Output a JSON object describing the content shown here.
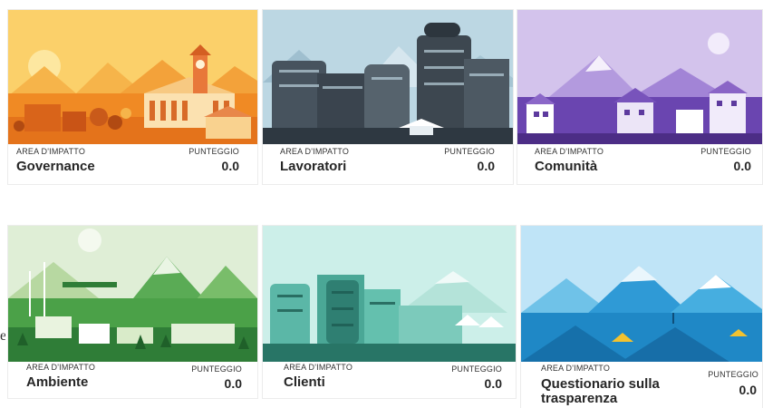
{
  "stray_text": "e",
  "cards": [
    {
      "id": "governance",
      "area_label": "AREA D'IMPATTO",
      "title": "Governance",
      "score_label": "PUNTEGGIO",
      "score": "0.0",
      "accent": "#f5a623"
    },
    {
      "id": "lavoratori",
      "area_label": "AREA D'IMPATTO",
      "title": "Lavoratori",
      "score_label": "PUNTEGGIO",
      "score": "0.0",
      "accent": "#5c7a8c"
    },
    {
      "id": "comunita",
      "area_label": "AREA D'IMPATTO",
      "title": "Comunità",
      "score_label": "PUNTEGGIO",
      "score": "0.0",
      "accent": "#8a63c9"
    },
    {
      "id": "ambiente",
      "area_label": "AREA D'IMPATTO",
      "title": "Ambiente",
      "score_label": "PUNTEGGIO",
      "score": "0.0",
      "accent": "#4caf50"
    },
    {
      "id": "clienti",
      "area_label": "AREA D'IMPATTO",
      "title": "Clienti",
      "score_label": "PUNTEGGIO",
      "score": "0.0",
      "accent": "#3cb7a3"
    },
    {
      "id": "trasparenza",
      "area_label": "AREA D'IMPATTO",
      "title": "Questionario sulla trasparenza",
      "score_label": "PUNTEGGIO",
      "score": "0.0",
      "accent": "#2a9fd6"
    }
  ]
}
